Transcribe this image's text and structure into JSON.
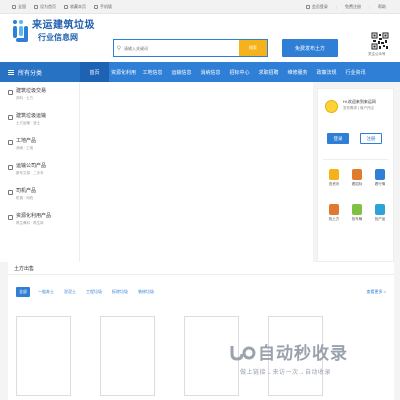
{
  "topbar": {
    "left": [
      "全国",
      "设为首页",
      "收藏本页",
      "手机版"
    ],
    "right": [
      "会员登录",
      "免费注册",
      "帮助"
    ]
  },
  "header": {
    "logo_line1": "来运建筑垃圾",
    "logo_line2": "行业信息网",
    "search_placeholder": "请输入关键词",
    "search_button": "搜索",
    "publish_button": "免费发布土方",
    "qr_caption": "关注公众号"
  },
  "nav": {
    "all_categories": "所有分类",
    "tabs": [
      "首页",
      "资源化利用",
      "工地信息",
      "运输信息",
      "消纳信息",
      "招标中心",
      "求职招聘",
      "维修服务",
      "政策法规",
      "行业资讯"
    ],
    "active_index": 0
  },
  "sidebar": {
    "categories": [
      {
        "title": "建筑垃圾交易",
        "sub": "弃料 · 土方"
      },
      {
        "title": "建筑垃圾运输",
        "sub": "土方运输 · 渣土"
      },
      {
        "title": "工地产品",
        "sub": "消纳 · 工地"
      },
      {
        "title": "运输公司产品",
        "sub": "新车交易 · 二手车"
      },
      {
        "title": "司机产品",
        "sub": "机械 · 司机"
      },
      {
        "title": "资源化利用产品",
        "sub": "再生骨料 · 再生砖"
      }
    ]
  },
  "userpanel": {
    "welcome": "Hi,欢迎来到来运网",
    "sub": "发布需求 | 商户开店",
    "login": "登录",
    "register": "注册",
    "quick_links": [
      {
        "label": "查资讯",
        "color": "#f6b21a"
      },
      {
        "label": "看招标",
        "color": "#e07a2f"
      },
      {
        "label": "看行情",
        "color": "#2f7fd6"
      },
      {
        "label": "找土方",
        "color": "#e07a2f"
      },
      {
        "label": "找车辆",
        "color": "#7fc241"
      },
      {
        "label": "找产品",
        "color": "#2fa3d6"
      }
    ]
  },
  "section": {
    "title": "土方出售",
    "filters": [
      "全部",
      "一般弃土",
      "淤泥土",
      "工程垃圾",
      "拆除垃圾",
      "装修垃圾"
    ],
    "more": "查看更多 >"
  },
  "watermark": {
    "text": "自动秒收录",
    "sub": "做上链接→来访一次→自动收录"
  }
}
